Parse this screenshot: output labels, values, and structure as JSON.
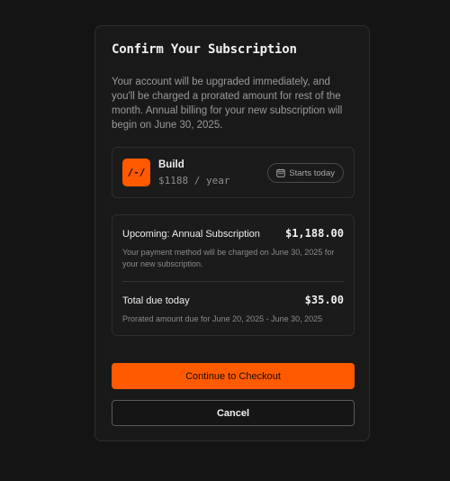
{
  "dialog": {
    "title": "Confirm Your Subscription",
    "description": "Your account will be upgraded immediately, and you'll be charged a prorated amount for rest of the month. Annual billing for your new subscription will begin on June 30, 2025."
  },
  "plan": {
    "logo_text": "/-/",
    "name": "Build",
    "price": "$1188 / year",
    "badge_icon": "calendar-icon",
    "badge_label": "Starts today"
  },
  "summary": {
    "upcoming_title": "Upcoming: Annual Subscription",
    "upcoming_amount": "$1,188.00",
    "upcoming_note": "Your payment method will be charged on June 30, 2025 for your new subscription.",
    "total_title": "Total due today",
    "total_amount": "$35.00",
    "total_note": "Prorated amount due for June 20, 2025 - June 30, 2025"
  },
  "actions": {
    "continue_label": "Continue to Checkout",
    "cancel_label": "Cancel"
  },
  "colors": {
    "accent": "#ff5a00",
    "background": "#141414",
    "panel": "#191919"
  }
}
